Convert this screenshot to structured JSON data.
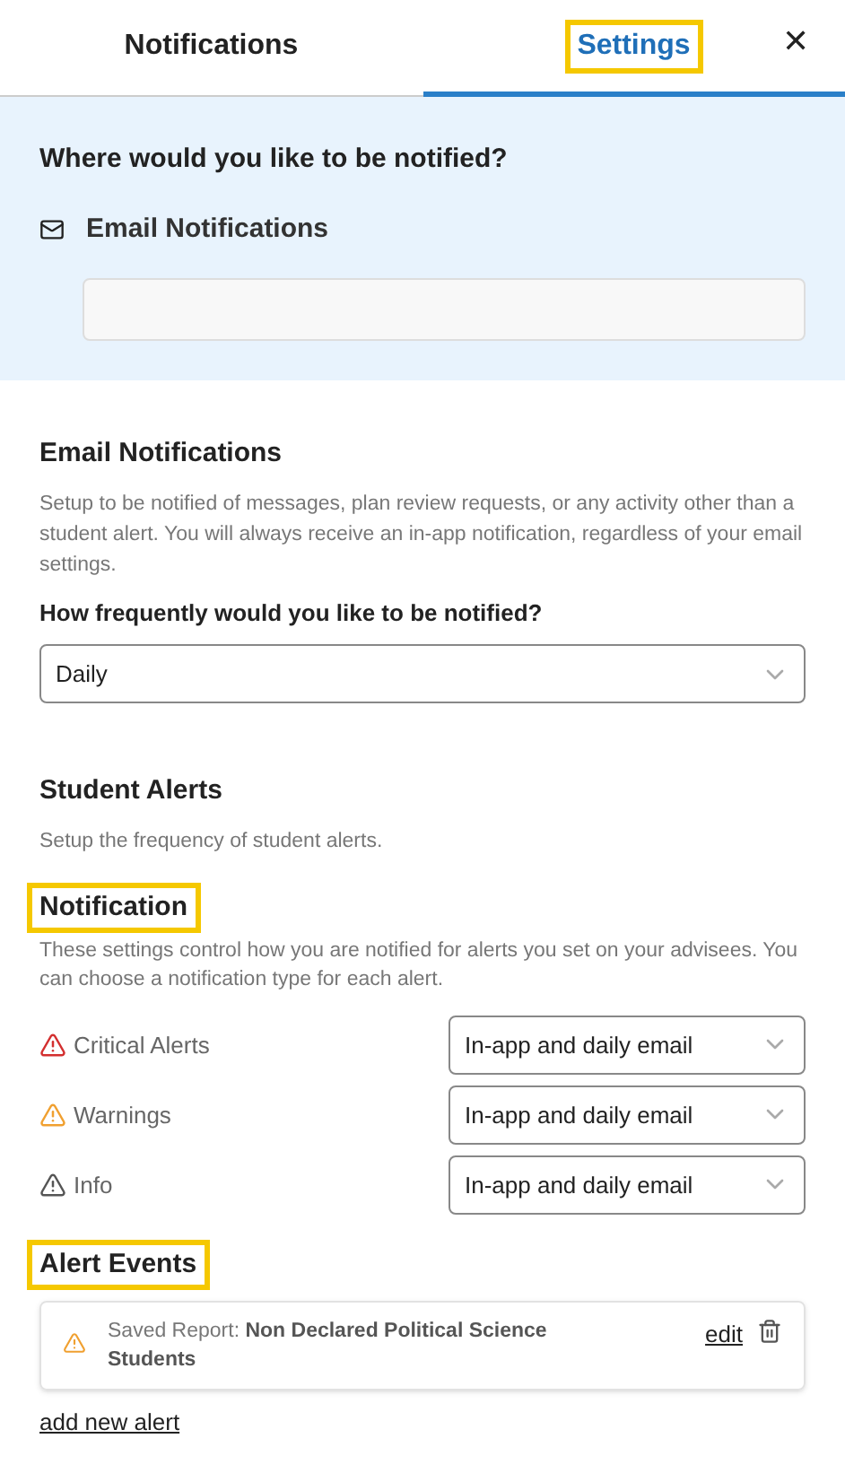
{
  "tabs": [
    {
      "label": "Notifications",
      "selected": false,
      "highlighted": false
    },
    {
      "label": "Settings",
      "selected": true,
      "highlighted": true
    }
  ],
  "close": "✕",
  "where": {
    "title": "Where would you like to be notified?",
    "channel": "Email Notifications"
  },
  "email_section": {
    "title": "Email Notifications",
    "description": "Setup to be notified of messages, plan review requests, or any activity other than a student alert. You will always receive an in-app notification, regardless of your email settings.",
    "question": "How frequently would you like to be notified?",
    "frequency": "Daily"
  },
  "student_alerts": {
    "title": "Student Alerts",
    "description": "Setup the frequency of student alerts."
  },
  "notification": {
    "title": "Notification",
    "highlighted": true,
    "description": "These settings control how you are notified for alerts you set on your advisees. You can choose a notification type for each alert.",
    "alerts": [
      {
        "label": "Critical Alerts",
        "color": "#d32f2f",
        "value": "In-app and daily email"
      },
      {
        "label": "Warnings",
        "color": "#f0a030",
        "value": "In-app and daily email"
      },
      {
        "label": "Info",
        "color": "#555555",
        "value": "In-app and daily email"
      }
    ]
  },
  "alert_events": {
    "title": "Alert Events",
    "highlighted": true,
    "items": [
      {
        "color": "#f0a030",
        "text": "Saved Report: **Non Declared Political Science Students**",
        "edit": "edit"
      }
    ],
    "add": "add new alert"
  }
}
